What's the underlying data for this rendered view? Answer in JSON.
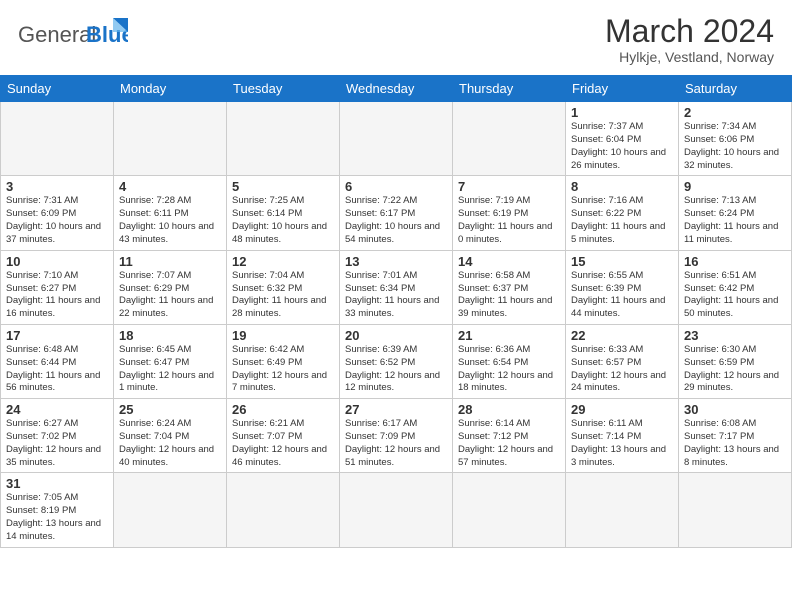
{
  "header": {
    "logo_general": "General",
    "logo_blue": "Blue",
    "month_title": "March 2024",
    "subtitle": "Hylkje, Vestland, Norway"
  },
  "days_of_week": [
    "Sunday",
    "Monday",
    "Tuesday",
    "Wednesday",
    "Thursday",
    "Friday",
    "Saturday"
  ],
  "weeks": [
    [
      {
        "day": "",
        "info": ""
      },
      {
        "day": "",
        "info": ""
      },
      {
        "day": "",
        "info": ""
      },
      {
        "day": "",
        "info": ""
      },
      {
        "day": "",
        "info": ""
      },
      {
        "day": "1",
        "info": "Sunrise: 7:37 AM\nSunset: 6:04 PM\nDaylight: 10 hours and 26 minutes."
      },
      {
        "day": "2",
        "info": "Sunrise: 7:34 AM\nSunset: 6:06 PM\nDaylight: 10 hours and 32 minutes."
      }
    ],
    [
      {
        "day": "3",
        "info": "Sunrise: 7:31 AM\nSunset: 6:09 PM\nDaylight: 10 hours and 37 minutes."
      },
      {
        "day": "4",
        "info": "Sunrise: 7:28 AM\nSunset: 6:11 PM\nDaylight: 10 hours and 43 minutes."
      },
      {
        "day": "5",
        "info": "Sunrise: 7:25 AM\nSunset: 6:14 PM\nDaylight: 10 hours and 48 minutes."
      },
      {
        "day": "6",
        "info": "Sunrise: 7:22 AM\nSunset: 6:17 PM\nDaylight: 10 hours and 54 minutes."
      },
      {
        "day": "7",
        "info": "Sunrise: 7:19 AM\nSunset: 6:19 PM\nDaylight: 11 hours and 0 minutes."
      },
      {
        "day": "8",
        "info": "Sunrise: 7:16 AM\nSunset: 6:22 PM\nDaylight: 11 hours and 5 minutes."
      },
      {
        "day": "9",
        "info": "Sunrise: 7:13 AM\nSunset: 6:24 PM\nDaylight: 11 hours and 11 minutes."
      }
    ],
    [
      {
        "day": "10",
        "info": "Sunrise: 7:10 AM\nSunset: 6:27 PM\nDaylight: 11 hours and 16 minutes."
      },
      {
        "day": "11",
        "info": "Sunrise: 7:07 AM\nSunset: 6:29 PM\nDaylight: 11 hours and 22 minutes."
      },
      {
        "day": "12",
        "info": "Sunrise: 7:04 AM\nSunset: 6:32 PM\nDaylight: 11 hours and 28 minutes."
      },
      {
        "day": "13",
        "info": "Sunrise: 7:01 AM\nSunset: 6:34 PM\nDaylight: 11 hours and 33 minutes."
      },
      {
        "day": "14",
        "info": "Sunrise: 6:58 AM\nSunset: 6:37 PM\nDaylight: 11 hours and 39 minutes."
      },
      {
        "day": "15",
        "info": "Sunrise: 6:55 AM\nSunset: 6:39 PM\nDaylight: 11 hours and 44 minutes."
      },
      {
        "day": "16",
        "info": "Sunrise: 6:51 AM\nSunset: 6:42 PM\nDaylight: 11 hours and 50 minutes."
      }
    ],
    [
      {
        "day": "17",
        "info": "Sunrise: 6:48 AM\nSunset: 6:44 PM\nDaylight: 11 hours and 56 minutes."
      },
      {
        "day": "18",
        "info": "Sunrise: 6:45 AM\nSunset: 6:47 PM\nDaylight: 12 hours and 1 minute."
      },
      {
        "day": "19",
        "info": "Sunrise: 6:42 AM\nSunset: 6:49 PM\nDaylight: 12 hours and 7 minutes."
      },
      {
        "day": "20",
        "info": "Sunrise: 6:39 AM\nSunset: 6:52 PM\nDaylight: 12 hours and 12 minutes."
      },
      {
        "day": "21",
        "info": "Sunrise: 6:36 AM\nSunset: 6:54 PM\nDaylight: 12 hours and 18 minutes."
      },
      {
        "day": "22",
        "info": "Sunrise: 6:33 AM\nSunset: 6:57 PM\nDaylight: 12 hours and 24 minutes."
      },
      {
        "day": "23",
        "info": "Sunrise: 6:30 AM\nSunset: 6:59 PM\nDaylight: 12 hours and 29 minutes."
      }
    ],
    [
      {
        "day": "24",
        "info": "Sunrise: 6:27 AM\nSunset: 7:02 PM\nDaylight: 12 hours and 35 minutes."
      },
      {
        "day": "25",
        "info": "Sunrise: 6:24 AM\nSunset: 7:04 PM\nDaylight: 12 hours and 40 minutes."
      },
      {
        "day": "26",
        "info": "Sunrise: 6:21 AM\nSunset: 7:07 PM\nDaylight: 12 hours and 46 minutes."
      },
      {
        "day": "27",
        "info": "Sunrise: 6:17 AM\nSunset: 7:09 PM\nDaylight: 12 hours and 51 minutes."
      },
      {
        "day": "28",
        "info": "Sunrise: 6:14 AM\nSunset: 7:12 PM\nDaylight: 12 hours and 57 minutes."
      },
      {
        "day": "29",
        "info": "Sunrise: 6:11 AM\nSunset: 7:14 PM\nDaylight: 13 hours and 3 minutes."
      },
      {
        "day": "30",
        "info": "Sunrise: 6:08 AM\nSunset: 7:17 PM\nDaylight: 13 hours and 8 minutes."
      }
    ],
    [
      {
        "day": "31",
        "info": "Sunrise: 7:05 AM\nSunset: 8:19 PM\nDaylight: 13 hours and 14 minutes."
      },
      {
        "day": "",
        "info": ""
      },
      {
        "day": "",
        "info": ""
      },
      {
        "day": "",
        "info": ""
      },
      {
        "day": "",
        "info": ""
      },
      {
        "day": "",
        "info": ""
      },
      {
        "day": "",
        "info": ""
      }
    ]
  ]
}
